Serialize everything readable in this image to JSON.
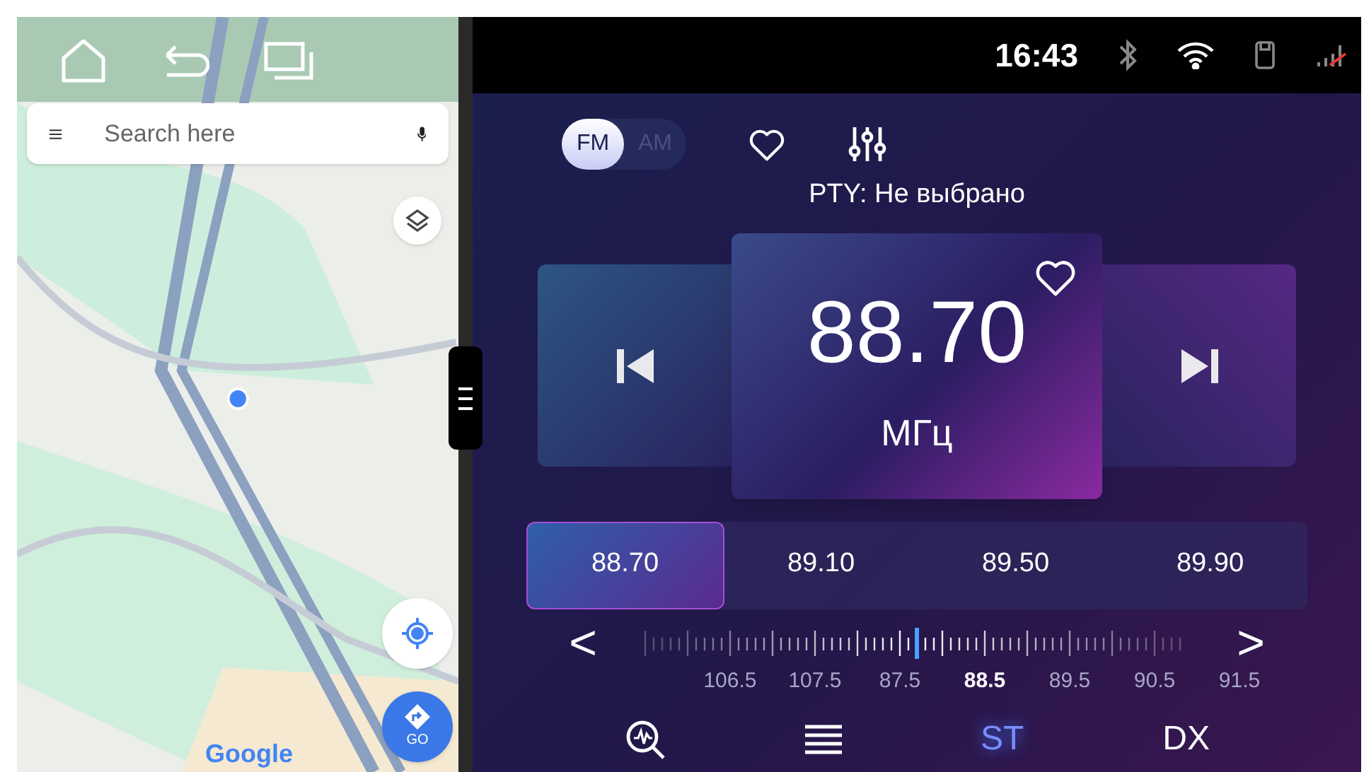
{
  "map": {
    "search": {
      "placeholder": "Search here"
    },
    "go_button": "GO",
    "logo": "Google"
  },
  "status_bar": {
    "time": "16:43"
  },
  "radio": {
    "bands": [
      {
        "label": "FM",
        "selected": true
      },
      {
        "label": "AM",
        "selected": false
      }
    ],
    "pty": "PTY: Не выбрано",
    "station": {
      "frequency": "88.70",
      "unit": "МГц",
      "favorite": false
    },
    "presets": [
      {
        "label": "88.70",
        "selected": true
      },
      {
        "label": "89.10",
        "selected": false
      },
      {
        "label": "89.50",
        "selected": false
      },
      {
        "label": "89.90",
        "selected": false
      }
    ],
    "scale": [
      {
        "label": "106.5",
        "selected": false
      },
      {
        "label": "107.5",
        "selected": false
      },
      {
        "label": "87.5",
        "selected": false
      },
      {
        "label": "88.5",
        "selected": true
      },
      {
        "label": "89.5",
        "selected": false
      },
      {
        "label": "90.5",
        "selected": false
      },
      {
        "label": "91.5",
        "selected": false
      }
    ],
    "scale_prev": "<",
    "scale_next": ">",
    "modes": [
      {
        "label": "ST",
        "on": true
      },
      {
        "label": "DX",
        "on": false
      }
    ]
  }
}
